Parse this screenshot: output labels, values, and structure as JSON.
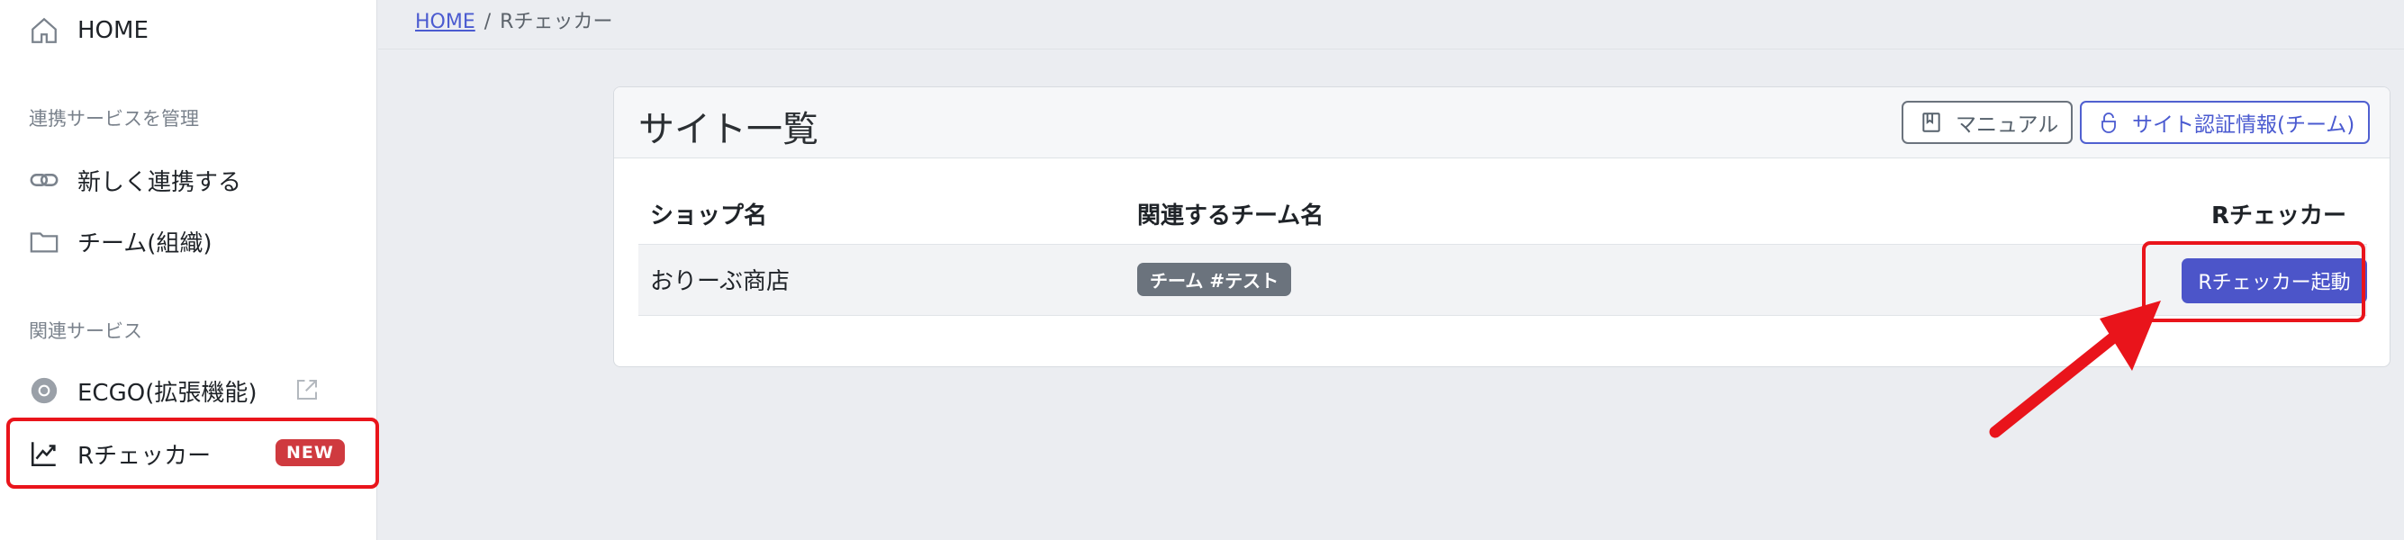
{
  "sidebar": {
    "home_label": "HOME",
    "section_manage": "連携サービスを管理",
    "new_link_label": "新しく連携する",
    "team_label": "チーム(組織)",
    "section_related": "関連サービス",
    "ecgo_label": "ECGO(拡張機能)",
    "rchecker_label": "Rチェッカー",
    "new_badge": "NEW"
  },
  "breadcrumb": {
    "home": "HOME",
    "separator": "/",
    "current": "Rチェッカー"
  },
  "card": {
    "title": "サイト一覧",
    "manual_button": "マニュアル",
    "auth_button": "サイト認証情報(チーム)"
  },
  "table": {
    "headers": [
      "ショップ名",
      "関連するチーム名",
      "Rチェッカー"
    ],
    "rows": [
      {
        "shop": "おりーぶ商店",
        "team": "チーム #テスト",
        "action": "Rチェッカー起動"
      }
    ]
  },
  "colors": {
    "accent": "#4c55c9",
    "highlight": "#e9141b",
    "new_badge": "#cf3a3f",
    "team_badge": "#6b737d"
  }
}
